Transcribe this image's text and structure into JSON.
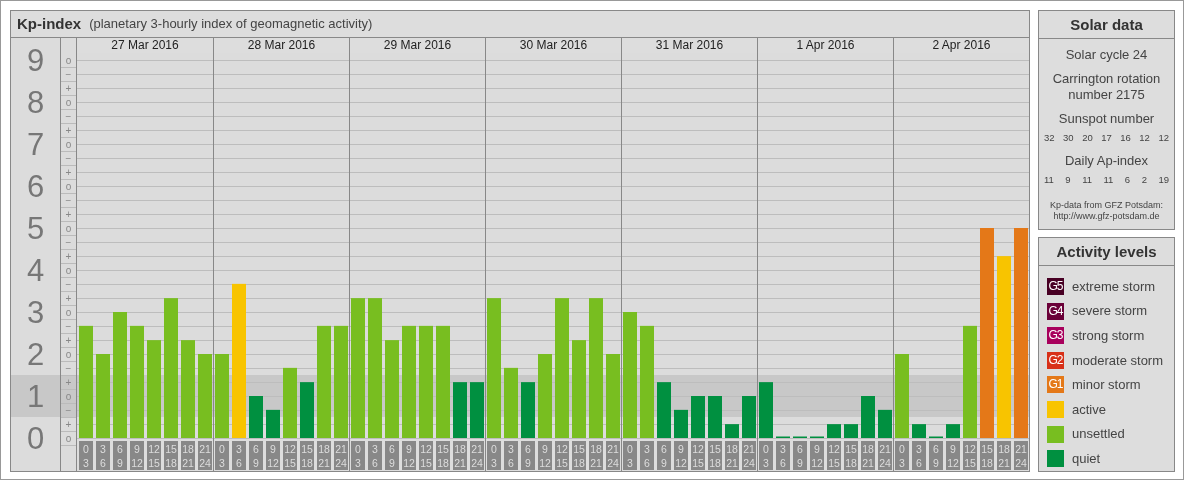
{
  "kp_panel": {
    "title": "Kp-index",
    "subtitle": "(planetary 3-hourly index of geomagnetic activity)",
    "days": [
      "27 Mar 2016",
      "28 Mar 2016",
      "29 Mar 2016",
      "30 Mar 2016",
      "31 Mar 2016",
      "1 Apr 2016",
      "2 Apr 2016"
    ],
    "sublevel_labels": [
      "o",
      "−",
      "+",
      "o",
      "−",
      "+",
      "o",
      "−",
      "+",
      "o",
      "−",
      "+",
      "o",
      "−",
      "+",
      "o",
      "−",
      "+",
      "o",
      "−",
      "+",
      "o",
      "−",
      "+",
      "o",
      "−",
      "+",
      "o"
    ],
    "chart_data": {
      "type": "bar",
      "ylim": [
        0,
        9
      ],
      "grid": true,
      "yticks": [
        0,
        1,
        2,
        3,
        4,
        5,
        6,
        7,
        8,
        9
      ],
      "categories": [
        "0 3",
        "3 6",
        "6 9",
        "9 12",
        "12 15",
        "15 18",
        "18 21",
        "21 24",
        "0 3",
        "3 6",
        "6 9",
        "9 12",
        "12 15",
        "15 18",
        "18 21",
        "21 24",
        "0 3",
        "3 6",
        "6 9",
        "9 12",
        "12 15",
        "15 18",
        "18 21",
        "21 24",
        "0 3",
        "3 6",
        "6 9",
        "9 12",
        "12 15",
        "15 18",
        "18 21",
        "21 24",
        "0 3",
        "3 6",
        "6 9",
        "9 12",
        "12 15",
        "15 18",
        "18 21",
        "21 24",
        "0 3",
        "3 6",
        "6 9",
        "9 12",
        "12 15",
        "15 18",
        "18 21",
        "21 24",
        "0 3",
        "3 6",
        "6 9",
        "9 12",
        "12 15",
        "15 18",
        "18 21",
        "21 24"
      ],
      "series": [
        {
          "color": "#009040",
          "values": [
            null,
            null,
            null,
            null,
            null,
            null,
            null,
            null,
            null,
            null,
            1,
            0.67,
            null,
            1.33,
            null,
            null,
            null,
            null,
            null,
            null,
            null,
            null,
            1.33,
            1.33,
            null,
            null,
            1.33,
            null,
            null,
            null,
            null,
            null,
            null,
            null,
            1.33,
            0.67,
            1,
            1,
            0.33,
            1,
            1.33,
            0,
            0,
            0,
            0.33,
            0.33,
            1,
            0.67,
            null,
            0.33,
            0,
            0.33,
            null,
            null,
            null,
            null
          ]
        },
        {
          "color": "#78be20",
          "values": [
            2.67,
            2,
            3,
            2.67,
            2.33,
            3.33,
            2.33,
            2,
            2,
            null,
            null,
            null,
            1.67,
            null,
            2.67,
            2.67,
            3.33,
            3.33,
            2.33,
            2.67,
            2.67,
            2.67,
            null,
            null,
            3.33,
            1.67,
            null,
            2,
            3.33,
            2.33,
            3.33,
            2,
            3,
            2.67,
            null,
            null,
            null,
            null,
            null,
            null,
            null,
            null,
            null,
            null,
            null,
            null,
            null,
            null,
            2,
            null,
            null,
            null,
            2.67,
            null,
            null,
            null
          ]
        },
        {
          "color": "#f8c400",
          "values": [
            null,
            null,
            null,
            null,
            null,
            null,
            null,
            null,
            null,
            3.67,
            null,
            null,
            null,
            null,
            null,
            null,
            null,
            null,
            null,
            null,
            null,
            null,
            null,
            null,
            null,
            null,
            null,
            null,
            null,
            null,
            null,
            null,
            null,
            null,
            null,
            null,
            null,
            null,
            null,
            null,
            null,
            null,
            null,
            null,
            null,
            null,
            null,
            null,
            null,
            null,
            null,
            null,
            null,
            null,
            4.33,
            null
          ]
        },
        {
          "color": "#e47818",
          "values": [
            null,
            null,
            null,
            null,
            null,
            null,
            null,
            null,
            null,
            null,
            null,
            null,
            null,
            null,
            null,
            null,
            null,
            null,
            null,
            null,
            null,
            null,
            null,
            null,
            null,
            null,
            null,
            null,
            null,
            null,
            null,
            null,
            null,
            null,
            null,
            null,
            null,
            null,
            null,
            null,
            null,
            null,
            null,
            null,
            null,
            null,
            null,
            null,
            null,
            null,
            null,
            null,
            null,
            5,
            null,
            5
          ]
        }
      ]
    }
  },
  "solar_panel": {
    "title": "Solar data",
    "lines": [
      "Solar cycle 24",
      "Carrington rotation number 2175"
    ],
    "sunspot": {
      "label": "Sunspot number",
      "values": [
        "32",
        "30",
        "20",
        "17",
        "16",
        "12",
        "12"
      ]
    },
    "ap": {
      "label": "Daily Ap-index",
      "values": [
        "11",
        "9",
        "11",
        "11",
        "6",
        "2",
        "19"
      ]
    },
    "credit": [
      "Kp-data from GFZ Potsdam:",
      "http://www.gfz-potsdam.de"
    ]
  },
  "activity_panel": {
    "title": "Activity levels",
    "levels": [
      {
        "badge": "G5",
        "label": "extreme storm",
        "color": "#480024"
      },
      {
        "badge": "G4",
        "label": "severe storm",
        "color": "#6a0038"
      },
      {
        "badge": "G3",
        "label": "strong storm",
        "color": "#a8005c"
      },
      {
        "badge": "G2",
        "label": "moderate storm",
        "color": "#d83018"
      },
      {
        "badge": "G1",
        "label": "minor storm",
        "color": "#e47818"
      },
      {
        "label": "active",
        "color": "#f8c400"
      },
      {
        "label": "unsettled",
        "color": "#78be20"
      },
      {
        "label": "quiet",
        "color": "#009040"
      }
    ]
  }
}
